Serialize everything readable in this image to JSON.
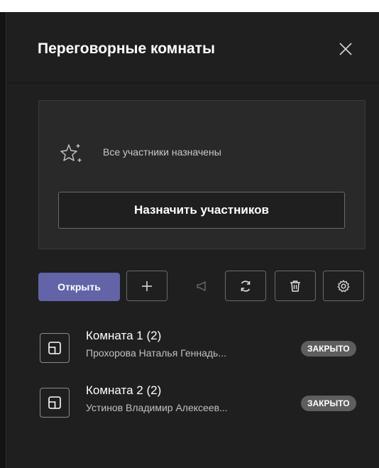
{
  "panel": {
    "title": "Переговорные комнаты"
  },
  "assign_card": {
    "status_text": "Все участники назначены",
    "assign_button_label": "Назначить участников"
  },
  "toolbar": {
    "open_label": "Открыть"
  },
  "rooms": [
    {
      "name": "Комната 1 (2)",
      "participants": "Прохорова Наталья Геннадь...",
      "status": "ЗАКРЫТО"
    },
    {
      "name": "Комната 2 (2)",
      "participants": "Устинов Владимир Алексеев...",
      "status": "ЗАКРЫТО"
    }
  ],
  "colors": {
    "accent": "#6264a7",
    "background": "#1f1f1f",
    "card": "#292929",
    "badge": "#5e5e5e"
  }
}
